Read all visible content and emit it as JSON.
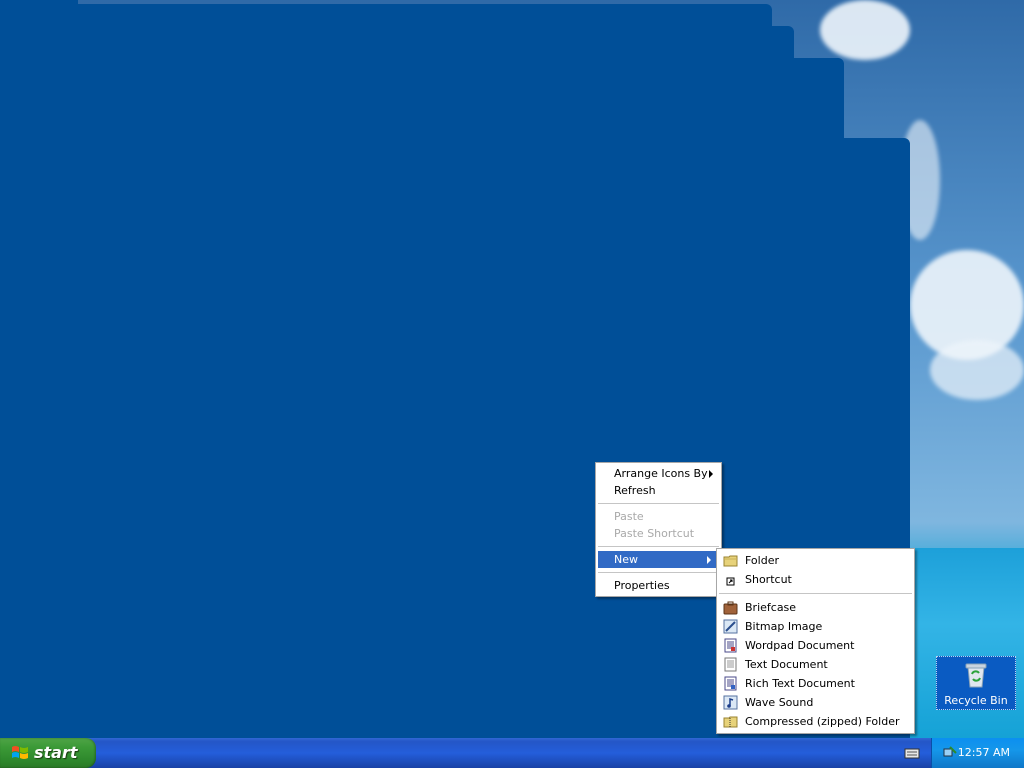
{
  "desktop": {
    "recycle_bin_label": "Recycle Bin"
  },
  "context_menu": {
    "items": [
      {
        "label": "Arrange Icons By",
        "has_submenu": true
      },
      {
        "label": "Refresh"
      },
      {
        "label": "Paste",
        "disabled": true
      },
      {
        "label": "Paste Shortcut",
        "disabled": true
      },
      {
        "label": "New",
        "has_submenu": true,
        "selected": true
      },
      {
        "label": "Properties"
      }
    ]
  },
  "new_submenu": {
    "items": [
      {
        "label": "Folder",
        "icon": "folder-icon",
        "accel": "F"
      },
      {
        "label": "Shortcut",
        "icon": "shortcut-icon",
        "accel": "S"
      },
      {
        "label": "Briefcase",
        "icon": "briefcase-icon"
      },
      {
        "label": "Bitmap Image",
        "icon": "bitmap-image-icon"
      },
      {
        "label": "Wordpad Document",
        "icon": "wordpad-document-icon"
      },
      {
        "label": "Text Document",
        "icon": "text-document-icon"
      },
      {
        "label": "Rich Text Document",
        "icon": "rich-text-document-icon"
      },
      {
        "label": "Wave Sound",
        "icon": "wave-sound-icon"
      },
      {
        "label": "Compressed (zipped) Folder",
        "icon": "zipped-folder-icon"
      }
    ]
  },
  "taskbar": {
    "start_label": "start",
    "clock": "12:57 AM"
  },
  "colors": {
    "desktop_block": "#004f98",
    "menu_highlight": "#316ac5",
    "taskbar": "#245edb",
    "start_green": "#3c9a37"
  }
}
